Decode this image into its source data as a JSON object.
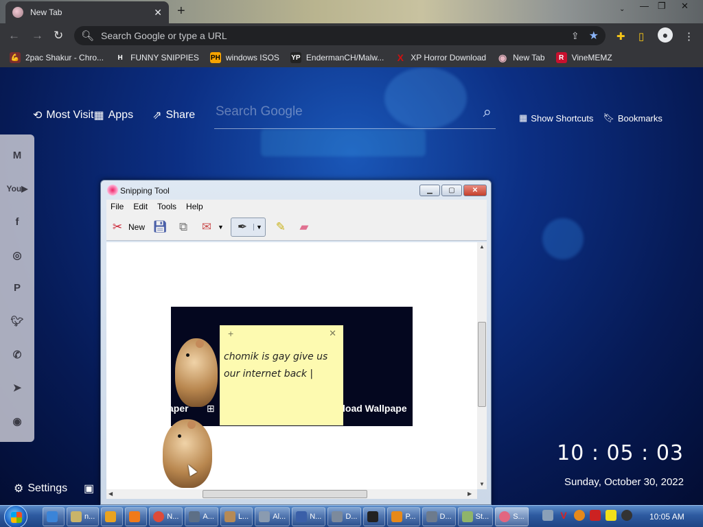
{
  "browser": {
    "tab_title": "New Tab",
    "tab_close": "✕",
    "new_tab": "+",
    "win_minimize": "—",
    "win_restore": "❐",
    "win_close": "✕",
    "omnibox_placeholder": "Search Google or type a URL"
  },
  "bookmarks": [
    {
      "label": "2pac Shakur - Chro...",
      "icon": "💪",
      "color": "#7a2e2e"
    },
    {
      "label": "FUNNY SNIPPIES",
      "icon": "H",
      "color": "#ffffff"
    },
    {
      "label": "windows ISOS",
      "icon": "PH",
      "color": "#f7a400"
    },
    {
      "label": "EndermanCH/Malw...",
      "icon": "YP",
      "color": "#222222"
    },
    {
      "label": "XP Horror Download",
      "icon": "X",
      "color": "#d01010"
    },
    {
      "label": "New Tab",
      "icon": "◉",
      "color": "#a07e86"
    },
    {
      "label": "VineMEMZ",
      "icon": "R",
      "color": "#c8102e"
    }
  ],
  "newtab": {
    "most_visited": "Most Visit",
    "apps": "Apps",
    "share": "Share",
    "search_placeholder": "Search Google",
    "show_shortcuts": "Show Shortcuts",
    "bookmarks": "Bookmarks",
    "settings": "Settings",
    "clock": "10 : 05 : 03",
    "date": "Sunday, October 30, 2022",
    "social": [
      "gmail-icon",
      "youtube-icon",
      "facebook-icon",
      "instagram-icon",
      "pinterest-icon",
      "twitter-icon",
      "whatsapp-icon",
      "telegram-icon",
      "reddit-icon"
    ]
  },
  "snipping_tool": {
    "title": "Snipping Tool",
    "menu": [
      "File",
      "Edit",
      "Tools",
      "Help"
    ],
    "new_label": "New",
    "capture_left_text": "aper",
    "capture_right_text": "load Wallpape",
    "sticky_text": "chomik is gay give us our internet back |"
  },
  "taskbar": {
    "tasks": [
      {
        "label": "",
        "color": "#3b84d8"
      },
      {
        "label": "",
        "color": "#2f6fc4"
      },
      {
        "label": "n...",
        "color": "#c9b46a"
      },
      {
        "label": "",
        "color": "#e9a321"
      },
      {
        "label": "",
        "color": "#f07a1a"
      },
      {
        "label": "N...",
        "color": "#dd4b39"
      },
      {
        "label": "A...",
        "color": "#5d6f86"
      },
      {
        "label": "L...",
        "color": "#b58a56"
      },
      {
        "label": "Al...",
        "color": "#8a9bb0"
      },
      {
        "label": "N...",
        "color": "#3a5fa8"
      },
      {
        "label": "D...",
        "color": "#7c8a9c"
      },
      {
        "label": "",
        "color": "#222222"
      },
      {
        "label": "P...",
        "color": "#e6891a"
      },
      {
        "label": "D...",
        "color": "#6d7b8d"
      },
      {
        "label": "St...",
        "color": "#8fb46a"
      },
      {
        "label": "S...",
        "color": "#e26680"
      }
    ],
    "time": "10:05 AM"
  }
}
